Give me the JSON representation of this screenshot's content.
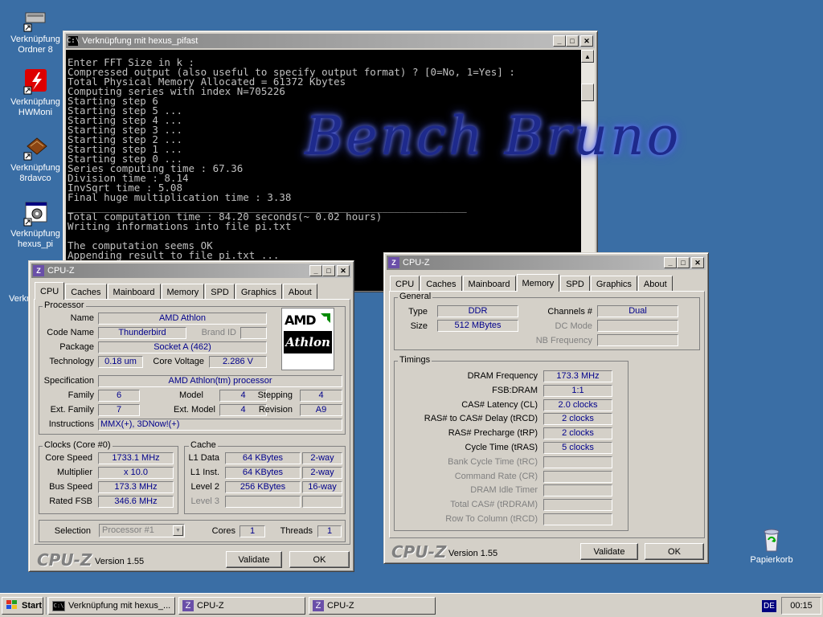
{
  "desktop": {
    "icons": [
      {
        "label": "Verknüpfung\nOrdner 8",
        "name": "ordner"
      },
      {
        "label": "Verknüpfung\nHWMoni",
        "name": "hwmonitor"
      },
      {
        "label": "Verknüpfung\n8rdavco",
        "name": "8rdavcore"
      },
      {
        "label": "Verknüpfung\nhexus_pi",
        "name": "hexus-pifast"
      },
      {
        "label": "Verkn",
        "name": "partial"
      },
      {
        "label": "Papierkorb",
        "name": "recycle-bin"
      }
    ],
    "watermark": "Bench Bruno"
  },
  "console_window": {
    "title": "Verknüpfung mit hexus_pifast",
    "lines": [
      "Enter FFT Size in k :",
      "Compressed output (also useful to specify output format) ? [0=No, 1=Yes] :",
      "Total Physical Memory Allocated = 61372 Kbytes",
      "Computing series with index N=705226",
      "Starting step 6",
      "Starting step 5 ...",
      "Starting step 4 ...",
      "Starting step 3 ...",
      "Starting step 2 ...",
      "Starting step 1 ...",
      "Starting step 0 ...",
      "Series computing time : 67.36",
      "Division time : 8.14",
      "InvSqrt time : 5.08",
      "Final huge multiplication time : 3.38",
      "__________________________________________________________________",
      "Total computation time : 84.20 seconds(~ 0.02 hours)",
      "Writing informations into file pi.txt",
      "",
      "The computation seems OK",
      "Appending result to file pi.txt ..."
    ]
  },
  "cpuz1": {
    "title": "CPU-Z",
    "tabs": [
      "CPU",
      "Caches",
      "Mainboard",
      "Memory",
      "SPD",
      "Graphics",
      "About"
    ],
    "processor": {
      "group": "Processor",
      "name_label": "Name",
      "name": "AMD Athlon",
      "codename_label": "Code Name",
      "codename": "Thunderbird",
      "brandid_label": "Brand ID",
      "brandid": "",
      "package_label": "Package",
      "package": "Socket A (462)",
      "technology_label": "Technology",
      "technology": "0.18 um",
      "voltage_label": "Core Voltage",
      "voltage": "2.286 V",
      "spec_label": "Specification",
      "spec": "AMD Athlon(tm) processor",
      "family_label": "Family",
      "family": "6",
      "model_label": "Model",
      "model": "4",
      "stepping_label": "Stepping",
      "stepping": "4",
      "extfamily_label": "Ext. Family",
      "extfamily": "7",
      "extmodel_label": "Ext. Model",
      "extmodel": "4",
      "revision_label": "Revision",
      "revision": "A9",
      "instructions_label": "Instructions",
      "instructions": "MMX(+), 3DNow!(+)",
      "logo_top": "AMD",
      "logo_bottom": "Athlon"
    },
    "clocks": {
      "group": "Clocks (Core #0)",
      "corespeed_label": "Core Speed",
      "corespeed": "1733.1 MHz",
      "multiplier_label": "Multiplier",
      "multiplier": "x 10.0",
      "busspeed_label": "Bus Speed",
      "busspeed": "173.3 MHz",
      "ratedfsb_label": "Rated FSB",
      "ratedfsb": "346.6 MHz"
    },
    "cache": {
      "group": "Cache",
      "l1data_label": "L1 Data",
      "l1data": "64 KBytes",
      "l1data_way": "2-way",
      "l1inst_label": "L1 Inst.",
      "l1inst": "64 KBytes",
      "l1inst_way": "2-way",
      "l2_label": "Level 2",
      "l2": "256 KBytes",
      "l2_way": "16-way",
      "l3_label": "Level 3"
    },
    "selection_label": "Selection",
    "selection": "Processor #1",
    "cores_label": "Cores",
    "cores": "1",
    "threads_label": "Threads",
    "threads": "1",
    "brand": "CPU-Z",
    "version": "Version 1.55",
    "validate": "Validate",
    "ok": "OK"
  },
  "cpuz2": {
    "title": "CPU-Z",
    "tabs": [
      "CPU",
      "Caches",
      "Mainboard",
      "Memory",
      "SPD",
      "Graphics",
      "About"
    ],
    "general": {
      "group": "General",
      "type_label": "Type",
      "type": "DDR",
      "size_label": "Size",
      "size": "512 MBytes",
      "channels_label": "Channels #",
      "channels": "Dual",
      "dcmode_label": "DC Mode",
      "nbfreq_label": "NB Frequency"
    },
    "timings": {
      "group": "Timings",
      "rows": [
        {
          "label": "DRAM Frequency",
          "value": "173.3 MHz",
          "active": true
        },
        {
          "label": "FSB:DRAM",
          "value": "1:1",
          "active": true
        },
        {
          "label": "CAS# Latency (CL)",
          "value": "2.0 clocks",
          "active": true
        },
        {
          "label": "RAS# to CAS# Delay (tRCD)",
          "value": "2 clocks",
          "active": true
        },
        {
          "label": "RAS# Precharge (tRP)",
          "value": "2 clocks",
          "active": true
        },
        {
          "label": "Cycle Time (tRAS)",
          "value": "5 clocks",
          "active": true
        },
        {
          "label": "Bank Cycle Time (tRC)",
          "value": "",
          "active": false
        },
        {
          "label": "Command Rate (CR)",
          "value": "",
          "active": false
        },
        {
          "label": "DRAM Idle Timer",
          "value": "",
          "active": false
        },
        {
          "label": "Total CAS# (tRDRAM)",
          "value": "",
          "active": false
        },
        {
          "label": "Row To Column (tRCD)",
          "value": "",
          "active": false
        }
      ]
    },
    "brand": "CPU-Z",
    "version": "Version 1.55",
    "validate": "Validate",
    "ok": "OK"
  },
  "taskbar": {
    "start": "Start",
    "items": [
      "Verknüpfung mit hexus_...",
      "CPU-Z",
      "CPU-Z"
    ],
    "lang": "DE",
    "clock": "00:15"
  }
}
